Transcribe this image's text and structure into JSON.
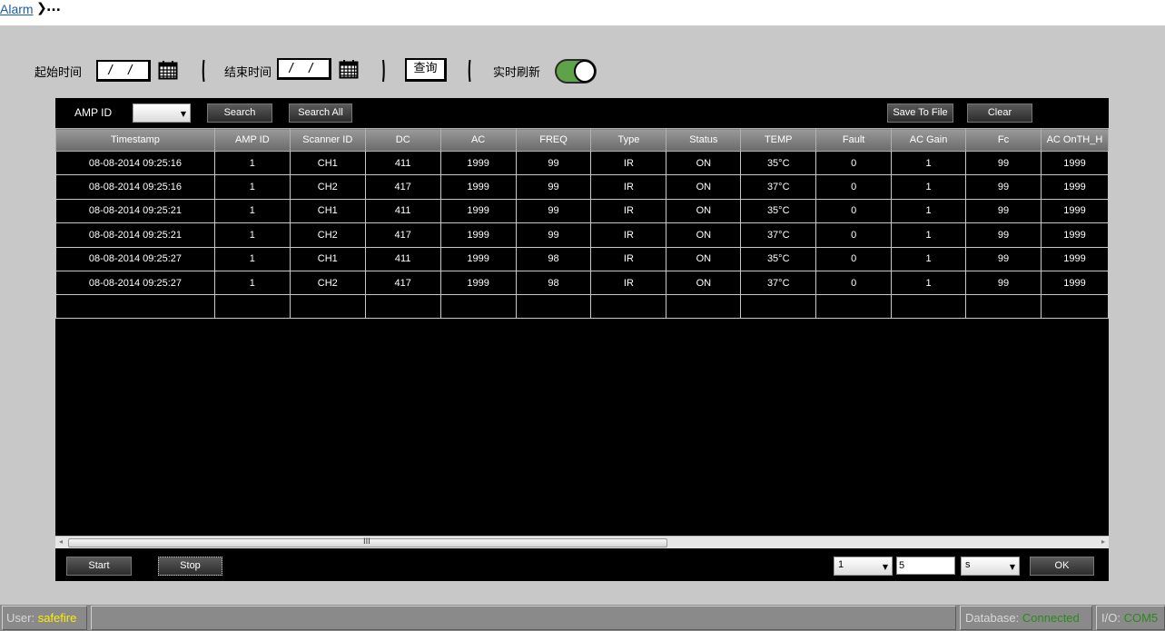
{
  "breadcrumb": {
    "link": "Alarm",
    "separator": "❯",
    "current": "..."
  },
  "filters": {
    "start_label": "起始时间",
    "start_value": "/ /",
    "end_label": "结束时间",
    "end_value": "/ /",
    "query_button": "查询",
    "realtime_label": "实时刷新",
    "realtime_on": true
  },
  "toolbar": {
    "amp_id_label": "AMP ID",
    "amp_id_value": "",
    "search": "Search",
    "search_all": "Search All",
    "save_to_file": "Save To File",
    "clear": "Clear"
  },
  "table": {
    "columns": [
      "Timestamp",
      "AMP ID",
      "Scanner ID",
      "DC",
      "AC",
      "FREQ",
      "Type",
      "Status",
      "TEMP",
      "Fault",
      "AC Gain",
      "Fc",
      "AC OnTH_H"
    ],
    "rows": [
      [
        "08-08-2014  09:25:16",
        "1",
        "CH1",
        "411",
        "1999",
        "99",
        "IR",
        "ON",
        "35°C",
        "0",
        "1",
        "99",
        "1999"
      ],
      [
        "08-08-2014  09:25:16",
        "1",
        "CH2",
        "417",
        "1999",
        "99",
        "IR",
        "ON",
        "37°C",
        "0",
        "1",
        "99",
        "1999"
      ],
      [
        "08-08-2014  09:25:21",
        "1",
        "CH1",
        "411",
        "1999",
        "99",
        "IR",
        "ON",
        "35°C",
        "0",
        "1",
        "99",
        "1999"
      ],
      [
        "08-08-2014  09:25:21",
        "1",
        "CH2",
        "417",
        "1999",
        "99",
        "IR",
        "ON",
        "37°C",
        "0",
        "1",
        "99",
        "1999"
      ],
      [
        "08-08-2014  09:25:27",
        "1",
        "CH1",
        "411",
        "1999",
        "98",
        "IR",
        "ON",
        "35°C",
        "0",
        "1",
        "99",
        "1999"
      ],
      [
        "08-08-2014  09:25:27",
        "1",
        "CH2",
        "417",
        "1999",
        "98",
        "IR",
        "ON",
        "37°C",
        "0",
        "1",
        "99",
        "1999"
      ]
    ]
  },
  "scrollbar": {
    "grip": "III"
  },
  "controls": {
    "start": "Start",
    "stop": "Stop",
    "page_select": "1",
    "interval_value": "5",
    "unit_select": "s",
    "ok": "OK"
  },
  "statusbar": {
    "user_label": "User:",
    "user_value": "safefire",
    "database_label": "Database:",
    "database_value": "Connected",
    "io_label": "I/O:",
    "io_value": "COM5"
  },
  "colors": {
    "background": "#c8c8c8",
    "panel": "#000000",
    "toggle_on": "#5ea34a",
    "user_value": "#ffee00",
    "status_ok": "#2a8a1a",
    "link": "#1a5ea8"
  },
  "icons": {
    "calendar": "calendar-icon",
    "chevron": "chevron-right-icon",
    "dropdown": "chevron-down-icon"
  }
}
